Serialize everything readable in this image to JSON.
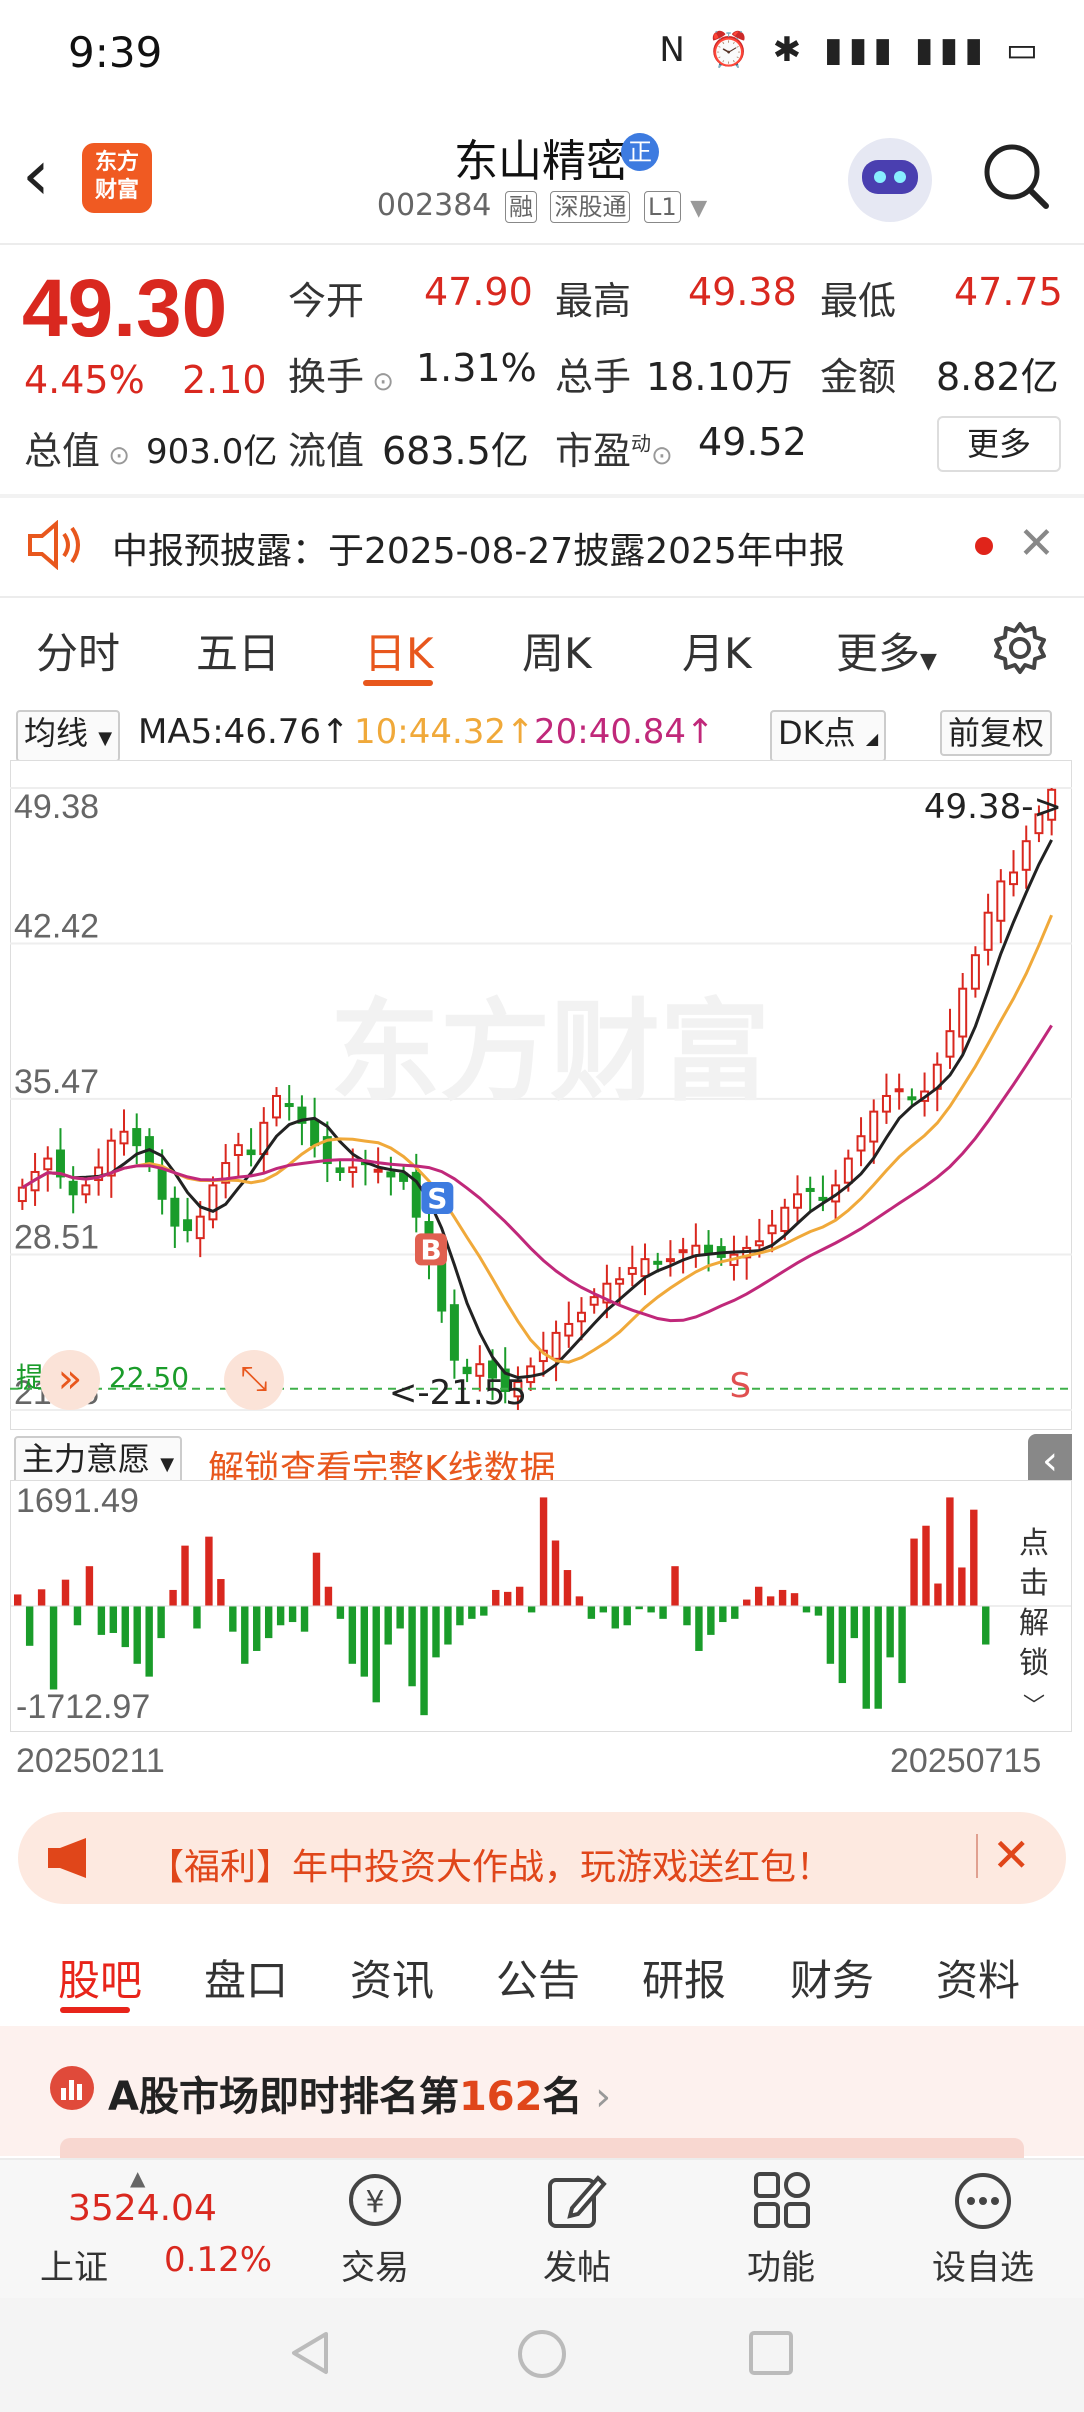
{
  "status": {
    "time": "9:39",
    "icons": "N ⏰ ✱ ▮▮▮ ▮▮▮ ▭"
  },
  "header": {
    "logo_line1": "东方",
    "logo_line2": "财富",
    "stock_name": "东山精密",
    "name_badge": "正",
    "code": "002384",
    "tags": [
      "融",
      "深股通",
      "L1"
    ]
  },
  "quote": {
    "price": "49.30",
    "change_pct": "4.45%",
    "change": "2.10",
    "open_label": "今开",
    "open": "47.90",
    "high_label": "最高",
    "high": "49.38",
    "low_label": "最低",
    "low": "47.75",
    "turnover_label": "换手",
    "turnover": "1.31%",
    "volume_label": "总手",
    "volume": "18.10万",
    "amount_label": "金额",
    "amount": "8.82亿",
    "mktcap_label": "总值",
    "mktcap": "903.0亿",
    "float_label": "流值",
    "float": "683.5亿",
    "pe_label": "市盈",
    "pe_sup": "动",
    "pe": "49.52",
    "more_label": "更多"
  },
  "notice": {
    "text": "中报预披露：于2025-08-27披露2025年中报"
  },
  "period_tabs": [
    "分时",
    "五日",
    "日K",
    "周K",
    "月K",
    "更多"
  ],
  "ma_legend": {
    "indicator": "均线",
    "ma5": "MA5:46.76↑",
    "ma10": "10:44.32↑",
    "ma20": "20:40.84↑",
    "dk": "DK点",
    "adjust": "前复权"
  },
  "colors": {
    "up": "#d9281f",
    "down": "#1a9c2a",
    "ma5": "#222222",
    "ma10": "#f0a93a",
    "ma20": "#c0287a",
    "accent": "#e8571d"
  },
  "chart_data": {
    "type": "candlestick",
    "y_ticks": [
      "49.38",
      "42.42",
      "35.47",
      "28.51",
      "21.55"
    ],
    "ylim": [
      21.55,
      49.38
    ],
    "high_marker": "49.38->",
    "low_marker": "<-21.55",
    "alert_label": "提醒价 22.50",
    "alert_price": 22.5,
    "signal_labels": [
      "S",
      "B",
      "S"
    ],
    "watermark": "东方财富",
    "x_start": "20250211",
    "x_end": "20250715",
    "closes": [
      31.5,
      32.2,
      32.8,
      32.0,
      31.2,
      31.6,
      32.4,
      33.6,
      34.0,
      33.4,
      32.6,
      31.0,
      29.8,
      29.6,
      30.2,
      31.6,
      32.6,
      33.4,
      33.0,
      34.4,
      35.6,
      35.2,
      34.4,
      33.4,
      32.6,
      32.2,
      32.4,
      32.6,
      32.3,
      32.0,
      31.8,
      30.2,
      28.4,
      26.0,
      23.8,
      23.2,
      23.6,
      23.0,
      22.4,
      22.8,
      23.5,
      24.2,
      25.0,
      25.4,
      25.9,
      26.6,
      27.2,
      27.4,
      27.9,
      28.3,
      28.1,
      28.3,
      28.7,
      28.9,
      28.6,
      28.4,
      28.5,
      28.8,
      29.1,
      29.8,
      30.6,
      31.2,
      31.4,
      31.0,
      31.6,
      32.8,
      33.8,
      34.9,
      35.6,
      35.9,
      35.5,
      35.8,
      37.0,
      38.5,
      40.4,
      41.9,
      43.8,
      45.2,
      45.6,
      47.0,
      48.2,
      49.3
    ]
  },
  "volume_panel": {
    "indicator": "主力意愿",
    "unlock_text": "解锁查看完整K线数据",
    "max_label": "1691.49",
    "min_label": "-1712.97",
    "side_unlock": "点击解锁",
    "values": [
      180,
      -620,
      260,
      -1300,
      410,
      -300,
      620,
      -450,
      -420,
      -640,
      -900,
      -1100,
      -500,
      250,
      940,
      -350,
      1080,
      420,
      -400,
      -900,
      -700,
      -500,
      -300,
      -250,
      -400,
      830,
      300,
      -200,
      -900,
      -1100,
      -1500,
      -600,
      -350,
      -1250,
      -1700,
      -800,
      -600,
      -300,
      -200,
      -150,
      250,
      220,
      300,
      -100,
      1691,
      1020,
      560,
      150,
      -200,
      -100,
      -350,
      -300,
      -50,
      -100,
      -200,
      620,
      -300,
      -700,
      -450,
      -250,
      -200,
      100,
      300,
      150,
      250,
      200,
      -100,
      -150,
      -900,
      -1200,
      -500,
      -1600,
      -1600,
      -800,
      -1200,
      1050,
      1250,
      350,
      1691,
      600,
      1500,
      -600
    ]
  },
  "promo": {
    "text": "【福利】年中投资大作战，玩游戏送红包！"
  },
  "bottom_tabs": [
    "股吧",
    "盘口",
    "资讯",
    "公告",
    "研报",
    "财务",
    "资料"
  ],
  "rank": {
    "prefix": "A股市场即时排名第",
    "number": "162",
    "suffix": "名"
  },
  "index_ticker": {
    "value": "3524.04",
    "name": "上证",
    "pct": "0.12%"
  },
  "nav": [
    "交易",
    "发帖",
    "功能",
    "设自选"
  ]
}
